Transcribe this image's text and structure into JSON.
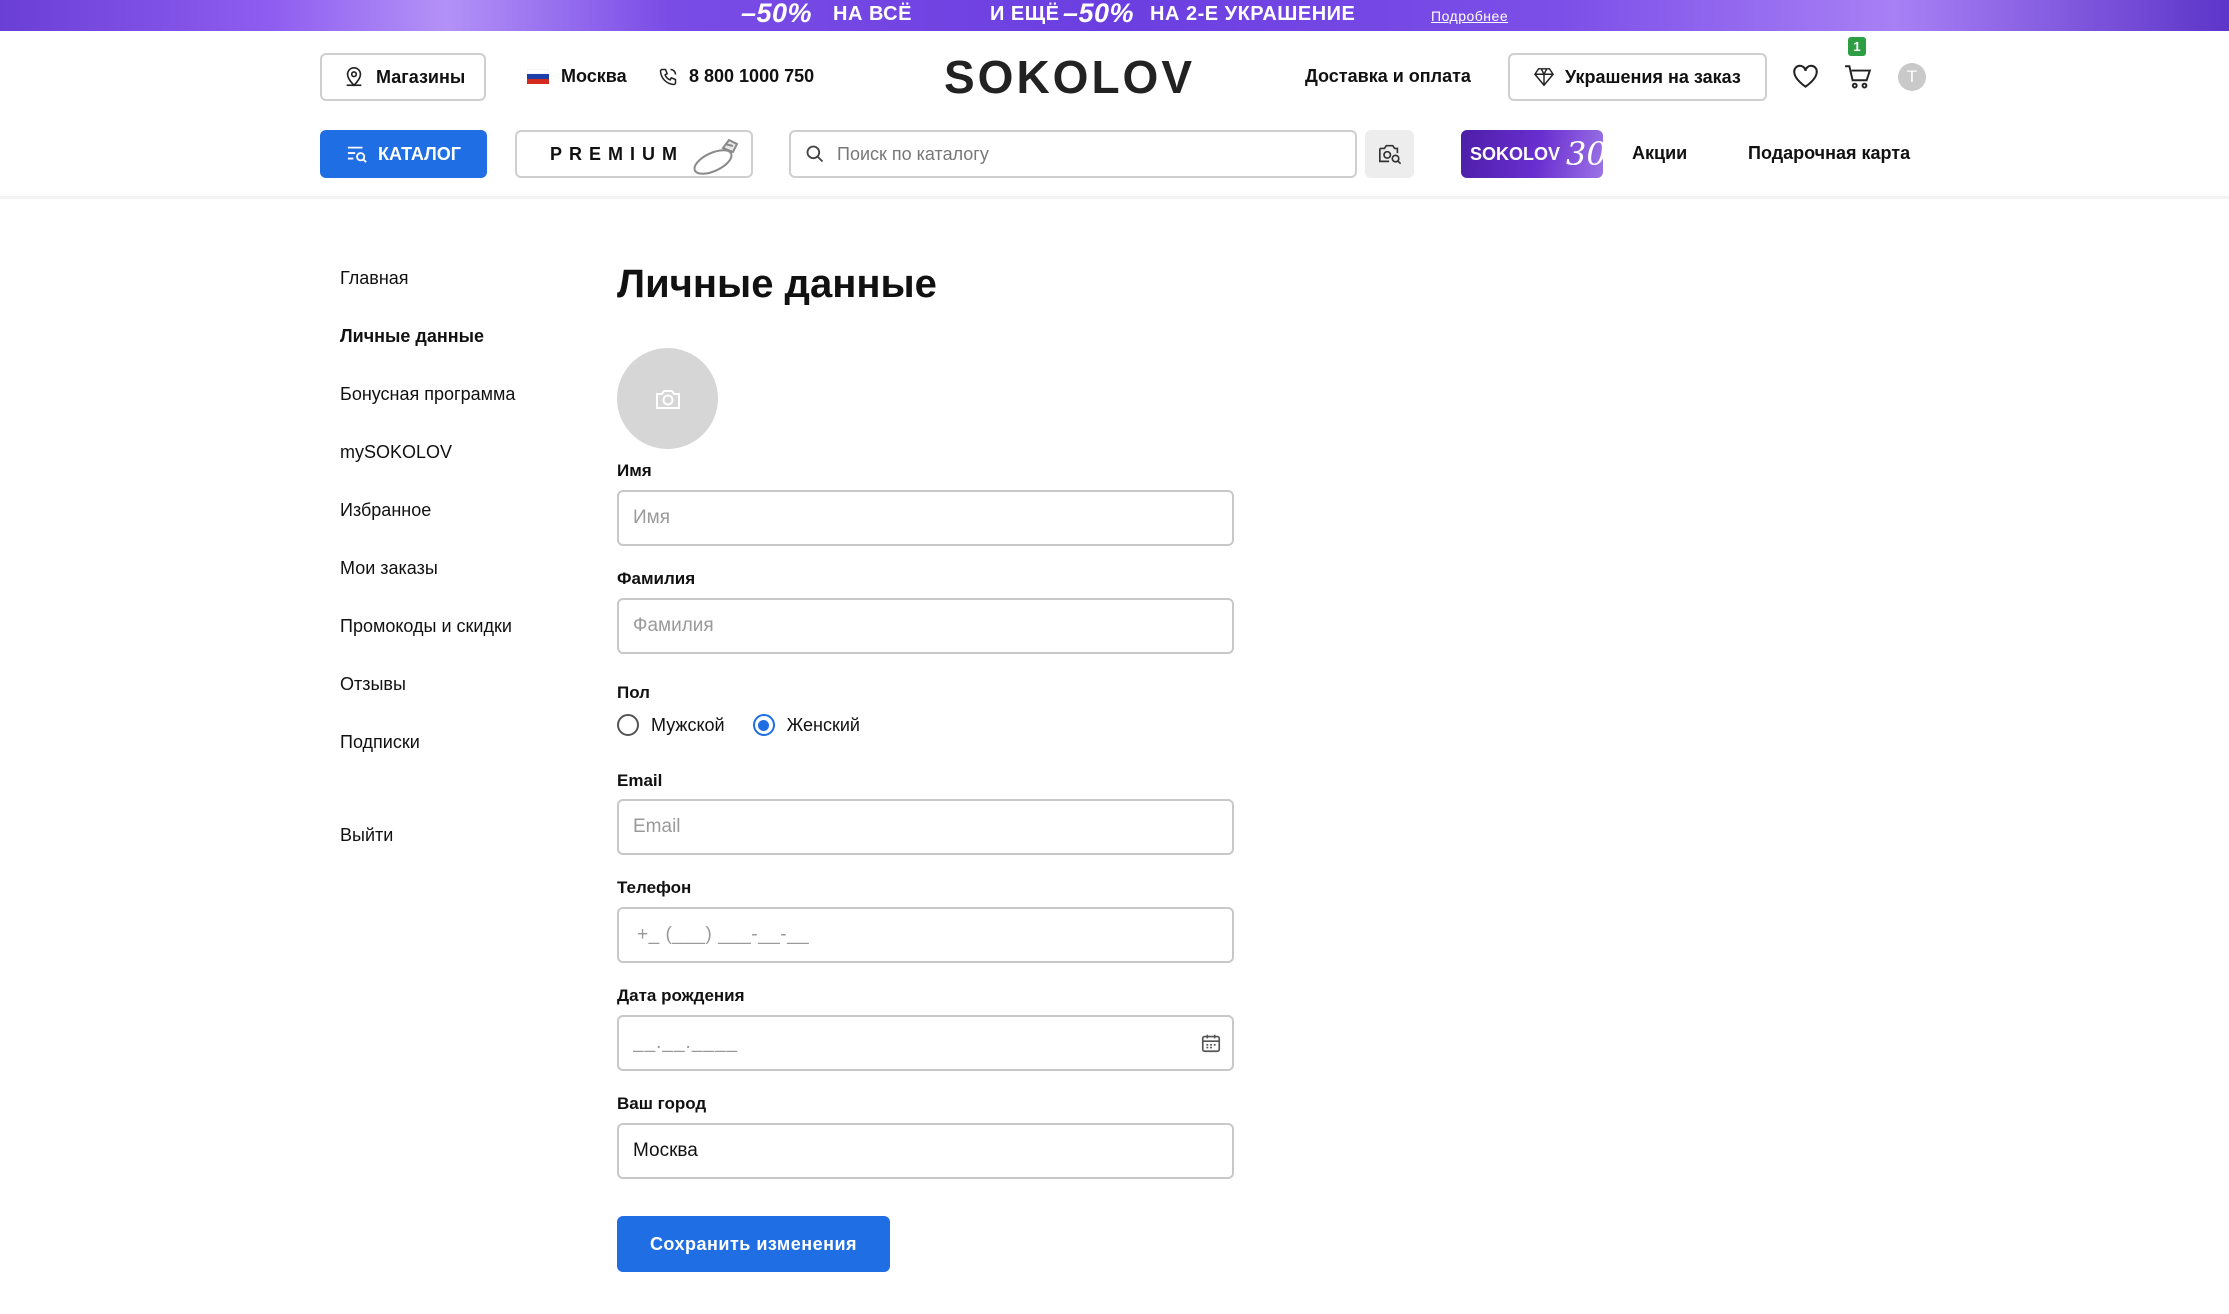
{
  "promo": {
    "part1_big": "–50%",
    "part1_text": "НА ВСЁ",
    "part2_prefix": "И ЕЩЁ",
    "part2_big": "–50%",
    "part2_text": "НА 2-Е УКРАШЕНИЕ",
    "more_link": "Подробнее"
  },
  "header": {
    "stores_label": "Магазины",
    "city_label": "Москва",
    "phone": "8 800 1000 750",
    "logo": "SOKOLOV",
    "delivery_label": "Доставка и оплата",
    "custom_order_label": "Украшения на заказ",
    "cart_count": "1",
    "user_initial": "T"
  },
  "nav": {
    "catalog_label": "КАТАЛОГ",
    "premium_label": "PREMIUM",
    "search_placeholder": "Поиск по каталогу",
    "sokolov30_text": "SOKOLOV",
    "sokolov30_num": "30",
    "promotions_label": "Акции",
    "gift_card_label": "Подарочная карта"
  },
  "sidebar": {
    "items": [
      {
        "label": "Главная"
      },
      {
        "label": "Личные данные"
      },
      {
        "label": "Бонусная программа"
      },
      {
        "label": "mySOKOLOV"
      },
      {
        "label": "Избранное"
      },
      {
        "label": "Мои заказы"
      },
      {
        "label": "Промокоды и скидки"
      },
      {
        "label": "Отзывы"
      },
      {
        "label": "Подписки"
      }
    ],
    "logout_label": "Выйти",
    "active_index": 1
  },
  "form": {
    "title": "Личные данные",
    "first_name": {
      "label": "Имя",
      "placeholder": "Имя",
      "value": ""
    },
    "last_name": {
      "label": "Фамилия",
      "placeholder": "Фамилия",
      "value": ""
    },
    "gender": {
      "label": "Пол",
      "male": "Мужской",
      "female": "Женский",
      "selected": "Женский"
    },
    "email": {
      "label": "Email",
      "placeholder": "Email",
      "value": ""
    },
    "phone": {
      "label": "Телефон",
      "placeholder": "+_ (___) ___-__-__",
      "value": ""
    },
    "birthdate": {
      "label": "Дата рождения",
      "placeholder": "__.__.____",
      "value": ""
    },
    "city": {
      "label": "Ваш город",
      "placeholder": "",
      "value": "Москва"
    },
    "save_label": "Сохранить изменения"
  },
  "colors": {
    "accent": "#1f6ee3",
    "cart_badge": "#2e9e44",
    "promo_purple": "#6b3ee0"
  }
}
